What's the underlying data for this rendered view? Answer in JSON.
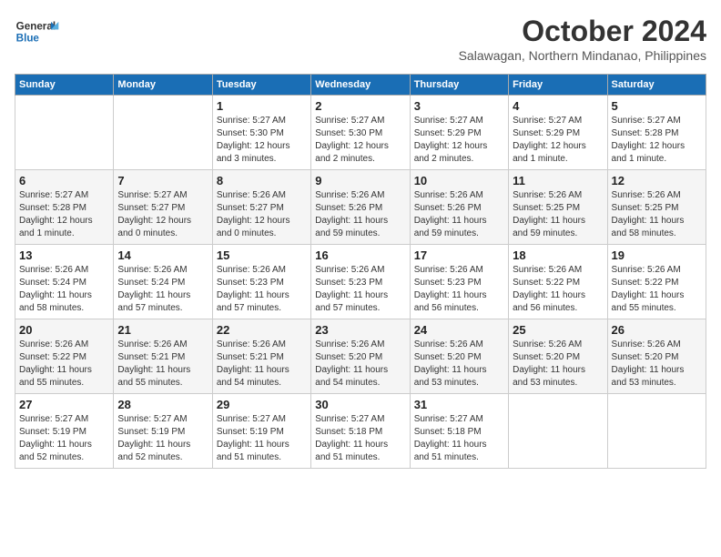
{
  "header": {
    "logo_line1": "General",
    "logo_line2": "Blue",
    "month": "October 2024",
    "location": "Salawagan, Northern Mindanao, Philippines"
  },
  "weekdays": [
    "Sunday",
    "Monday",
    "Tuesday",
    "Wednesday",
    "Thursday",
    "Friday",
    "Saturday"
  ],
  "weeks": [
    [
      {
        "day": "",
        "info": ""
      },
      {
        "day": "",
        "info": ""
      },
      {
        "day": "1",
        "info": "Sunrise: 5:27 AM\nSunset: 5:30 PM\nDaylight: 12 hours\nand 3 minutes."
      },
      {
        "day": "2",
        "info": "Sunrise: 5:27 AM\nSunset: 5:30 PM\nDaylight: 12 hours\nand 2 minutes."
      },
      {
        "day": "3",
        "info": "Sunrise: 5:27 AM\nSunset: 5:29 PM\nDaylight: 12 hours\nand 2 minutes."
      },
      {
        "day": "4",
        "info": "Sunrise: 5:27 AM\nSunset: 5:29 PM\nDaylight: 12 hours\nand 1 minute."
      },
      {
        "day": "5",
        "info": "Sunrise: 5:27 AM\nSunset: 5:28 PM\nDaylight: 12 hours\nand 1 minute."
      }
    ],
    [
      {
        "day": "6",
        "info": "Sunrise: 5:27 AM\nSunset: 5:28 PM\nDaylight: 12 hours\nand 1 minute."
      },
      {
        "day": "7",
        "info": "Sunrise: 5:27 AM\nSunset: 5:27 PM\nDaylight: 12 hours\nand 0 minutes."
      },
      {
        "day": "8",
        "info": "Sunrise: 5:26 AM\nSunset: 5:27 PM\nDaylight: 12 hours\nand 0 minutes."
      },
      {
        "day": "9",
        "info": "Sunrise: 5:26 AM\nSunset: 5:26 PM\nDaylight: 11 hours\nand 59 minutes."
      },
      {
        "day": "10",
        "info": "Sunrise: 5:26 AM\nSunset: 5:26 PM\nDaylight: 11 hours\nand 59 minutes."
      },
      {
        "day": "11",
        "info": "Sunrise: 5:26 AM\nSunset: 5:25 PM\nDaylight: 11 hours\nand 59 minutes."
      },
      {
        "day": "12",
        "info": "Sunrise: 5:26 AM\nSunset: 5:25 PM\nDaylight: 11 hours\nand 58 minutes."
      }
    ],
    [
      {
        "day": "13",
        "info": "Sunrise: 5:26 AM\nSunset: 5:24 PM\nDaylight: 11 hours\nand 58 minutes."
      },
      {
        "day": "14",
        "info": "Sunrise: 5:26 AM\nSunset: 5:24 PM\nDaylight: 11 hours\nand 57 minutes."
      },
      {
        "day": "15",
        "info": "Sunrise: 5:26 AM\nSunset: 5:23 PM\nDaylight: 11 hours\nand 57 minutes."
      },
      {
        "day": "16",
        "info": "Sunrise: 5:26 AM\nSunset: 5:23 PM\nDaylight: 11 hours\nand 57 minutes."
      },
      {
        "day": "17",
        "info": "Sunrise: 5:26 AM\nSunset: 5:23 PM\nDaylight: 11 hours\nand 56 minutes."
      },
      {
        "day": "18",
        "info": "Sunrise: 5:26 AM\nSunset: 5:22 PM\nDaylight: 11 hours\nand 56 minutes."
      },
      {
        "day": "19",
        "info": "Sunrise: 5:26 AM\nSunset: 5:22 PM\nDaylight: 11 hours\nand 55 minutes."
      }
    ],
    [
      {
        "day": "20",
        "info": "Sunrise: 5:26 AM\nSunset: 5:22 PM\nDaylight: 11 hours\nand 55 minutes."
      },
      {
        "day": "21",
        "info": "Sunrise: 5:26 AM\nSunset: 5:21 PM\nDaylight: 11 hours\nand 55 minutes."
      },
      {
        "day": "22",
        "info": "Sunrise: 5:26 AM\nSunset: 5:21 PM\nDaylight: 11 hours\nand 54 minutes."
      },
      {
        "day": "23",
        "info": "Sunrise: 5:26 AM\nSunset: 5:20 PM\nDaylight: 11 hours\nand 54 minutes."
      },
      {
        "day": "24",
        "info": "Sunrise: 5:26 AM\nSunset: 5:20 PM\nDaylight: 11 hours\nand 53 minutes."
      },
      {
        "day": "25",
        "info": "Sunrise: 5:26 AM\nSunset: 5:20 PM\nDaylight: 11 hours\nand 53 minutes."
      },
      {
        "day": "26",
        "info": "Sunrise: 5:26 AM\nSunset: 5:20 PM\nDaylight: 11 hours\nand 53 minutes."
      }
    ],
    [
      {
        "day": "27",
        "info": "Sunrise: 5:27 AM\nSunset: 5:19 PM\nDaylight: 11 hours\nand 52 minutes."
      },
      {
        "day": "28",
        "info": "Sunrise: 5:27 AM\nSunset: 5:19 PM\nDaylight: 11 hours\nand 52 minutes."
      },
      {
        "day": "29",
        "info": "Sunrise: 5:27 AM\nSunset: 5:19 PM\nDaylight: 11 hours\nand 51 minutes."
      },
      {
        "day": "30",
        "info": "Sunrise: 5:27 AM\nSunset: 5:18 PM\nDaylight: 11 hours\nand 51 minutes."
      },
      {
        "day": "31",
        "info": "Sunrise: 5:27 AM\nSunset: 5:18 PM\nDaylight: 11 hours\nand 51 minutes."
      },
      {
        "day": "",
        "info": ""
      },
      {
        "day": "",
        "info": ""
      }
    ]
  ]
}
